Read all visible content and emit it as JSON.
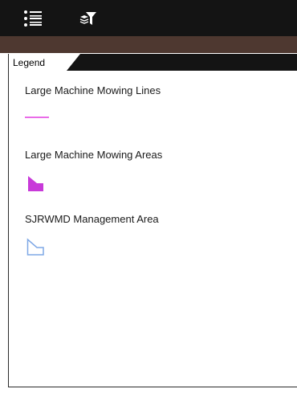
{
  "toolbar": {
    "buttons": [
      {
        "icon": "layer-list-icon"
      },
      {
        "icon": "layer-filter-icon"
      }
    ]
  },
  "legend": {
    "tab_label": "Legend",
    "layers": [
      {
        "title": "Large Machine Mowing Lines",
        "symbol": "line",
        "color": "#e23ce0"
      },
      {
        "title": "Large Machine Mowing Areas",
        "symbol": "polygon-fill",
        "color": "#c83ad9"
      },
      {
        "title": "SJRWMD Management Area",
        "symbol": "polygon-outline",
        "color": "#7fa8e6"
      }
    ]
  },
  "colors": {
    "toolbar_bg": "#141414",
    "header_bar": "#4e3830"
  }
}
